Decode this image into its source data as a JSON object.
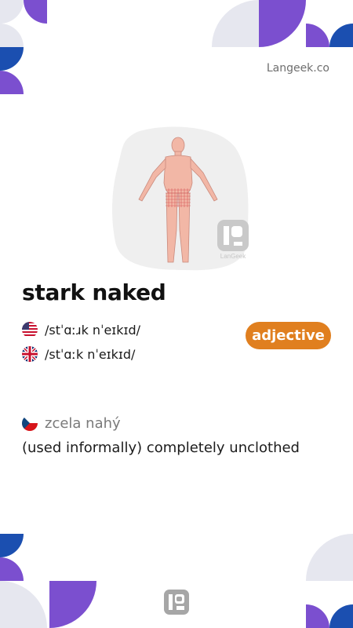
{
  "site": {
    "name": "Langeek.co"
  },
  "colors": {
    "purple": "#7b4fcf",
    "blue": "#1b4fb0",
    "light_gray": "#e6e7ef",
    "badge_orange": "#e07f1f"
  },
  "entry": {
    "word": "stark naked",
    "part_of_speech": "adjective",
    "pronunciations": [
      {
        "flag_icon": "us-flag-icon",
        "ipa": "/stˈɑːɹk nˈeɪkɪd/"
      },
      {
        "flag_icon": "uk-flag-icon",
        "ipa": "/stˈɑːk nˈeɪkɪd/"
      }
    ],
    "translation": {
      "flag_icon": "czech-flag-icon",
      "text": "zcela nahý"
    },
    "definition": "(used informally) completely unclothed"
  },
  "illustration": {
    "icon": "naked-man-illustration",
    "watermark_text": "LanGeek"
  }
}
